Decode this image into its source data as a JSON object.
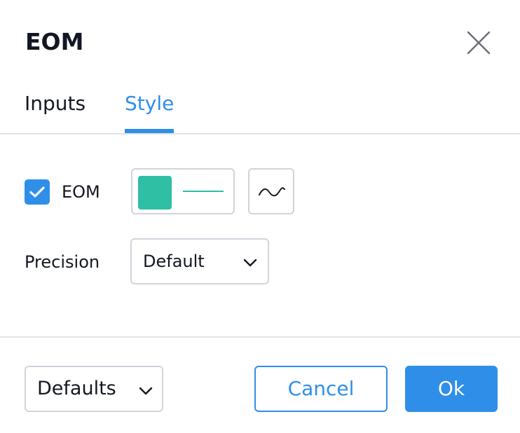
{
  "dialog": {
    "title": "EOM"
  },
  "tabs": [
    {
      "label": "Inputs",
      "active": false
    },
    {
      "label": "Style",
      "active": true
    }
  ],
  "style": {
    "eom_row": {
      "label": "EOM",
      "checked": true,
      "color": "#2ebfa5",
      "plot_icon": "wave-line-icon"
    },
    "precision": {
      "label": "Precision",
      "value": "Default"
    }
  },
  "footer": {
    "defaults_label": "Defaults",
    "cancel_label": "Cancel",
    "ok_label": "Ok"
  },
  "colors": {
    "accent": "#2f8fe8",
    "border": "#d1d4dc",
    "divider": "#e0e3eb",
    "text": "#131722",
    "series": "#2ebfa5"
  }
}
